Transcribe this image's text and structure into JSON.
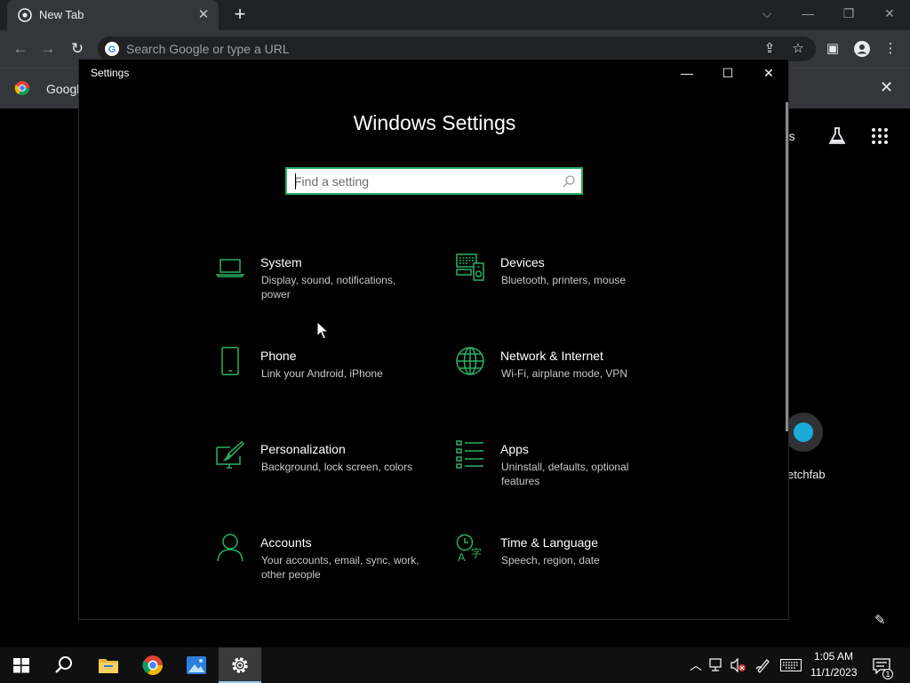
{
  "chrome": {
    "tab_title": "New Tab",
    "omnibox_placeholder": "Search Google or type a URL",
    "bookmark_label": "Googl",
    "ntp_images_label": "ges",
    "shortcut_label": "etchfab"
  },
  "settings": {
    "window_title": "Settings",
    "heading": "Windows Settings",
    "search_placeholder": "Find a setting",
    "accent_color": "#2ab066",
    "categories": [
      {
        "name": "System",
        "desc": "Display, sound, notifications, power",
        "icon": "laptop-icon"
      },
      {
        "name": "Devices",
        "desc": "Bluetooth, printers, mouse",
        "icon": "keyboard-speaker-icon"
      },
      {
        "name": "Phone",
        "desc": "Link your Android, iPhone",
        "icon": "phone-icon"
      },
      {
        "name": "Network & Internet",
        "desc": "Wi-Fi, airplane mode, VPN",
        "icon": "globe-icon"
      },
      {
        "name": "Personalization",
        "desc": "Background, lock screen, colors",
        "icon": "paint-brush-icon"
      },
      {
        "name": "Apps",
        "desc": "Uninstall, defaults, optional features",
        "icon": "apps-list-icon"
      },
      {
        "name": "Accounts",
        "desc": "Your accounts, email, sync, work, other people",
        "icon": "person-icon"
      },
      {
        "name": "Time & Language",
        "desc": "Speech, region, date",
        "icon": "time-language-icon"
      }
    ]
  },
  "taskbar": {
    "time": "1:05 AM",
    "date": "11/1/2023",
    "notification_count": "1"
  }
}
